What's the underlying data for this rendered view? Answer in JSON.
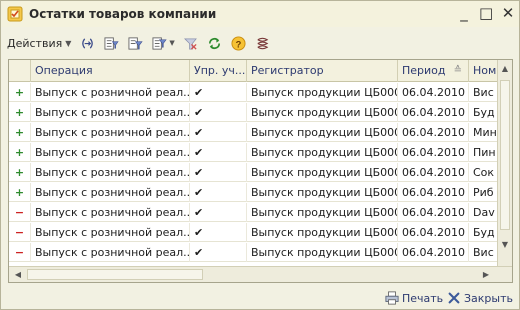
{
  "window": {
    "title": "Остатки товаров компании",
    "icon": "document-icon",
    "buttons": [
      "_",
      "□",
      "✕"
    ]
  },
  "toolbar": {
    "actions_label": "Действия",
    "icons": [
      "range-icon",
      "filter-list-icon",
      "filter-icon",
      "filter-menu-icon",
      "clear-filter-icon",
      "refresh-icon",
      "help-icon",
      "structure-icon"
    ]
  },
  "table": {
    "columns": [
      "",
      "Операция",
      "Упр. уч...",
      "Регистратор",
      "Период",
      "Ном"
    ],
    "rows": [
      {
        "sign": "+",
        "operation": "Выпуск с розничной реал...",
        "mgmt": "✔",
        "registrar": "Выпуск продукции ЦБ000...",
        "period": "06.04.2010 ...",
        "item": "Вис"
      },
      {
        "sign": "+",
        "operation": "Выпуск с розничной реал...",
        "mgmt": "✔",
        "registrar": "Выпуск продукции ЦБ000...",
        "period": "06.04.2010 ...",
        "item": "Буд"
      },
      {
        "sign": "+",
        "operation": "Выпуск с розничной реал...",
        "mgmt": "✔",
        "registrar": "Выпуск продукции ЦБ000...",
        "period": "06.04.2010 ...",
        "item": "Мин"
      },
      {
        "sign": "+",
        "operation": "Выпуск с розничной реал...",
        "mgmt": "✔",
        "registrar": "Выпуск продукции ЦБ000...",
        "period": "06.04.2010 ...",
        "item": "Пин"
      },
      {
        "sign": "+",
        "operation": "Выпуск с розничной реал...",
        "mgmt": "✔",
        "registrar": "Выпуск продукции ЦБ000...",
        "period": "06.04.2010 ...",
        "item": "Сок"
      },
      {
        "sign": "+",
        "operation": "Выпуск с розничной реал...",
        "mgmt": "✔",
        "registrar": "Выпуск продукции ЦБ000...",
        "period": "06.04.2010 ...",
        "item": "Риб"
      },
      {
        "sign": "−",
        "operation": "Выпуск с розничной реал...",
        "mgmt": "✔",
        "registrar": "Выпуск продукции ЦБ000...",
        "period": "06.04.2010 ...",
        "item": "Dav"
      },
      {
        "sign": "−",
        "operation": "Выпуск с розничной реал...",
        "mgmt": "✔",
        "registrar": "Выпуск продукции ЦБ000...",
        "period": "06.04.2010 ...",
        "item": "Буд"
      },
      {
        "sign": "−",
        "operation": "Выпуск с розничной реал...",
        "mgmt": "✔",
        "registrar": "Выпуск продукции ЦБ000...",
        "period": "06.04.2010 ...",
        "item": "Вис"
      }
    ]
  },
  "footer": {
    "print_label": "Печать",
    "close_label": "Закрыть"
  },
  "colors": {
    "plus": "#2e8b2e",
    "minus": "#cc2222",
    "header_text": "#2d3a70",
    "window_bg": "#f2f1e2"
  }
}
